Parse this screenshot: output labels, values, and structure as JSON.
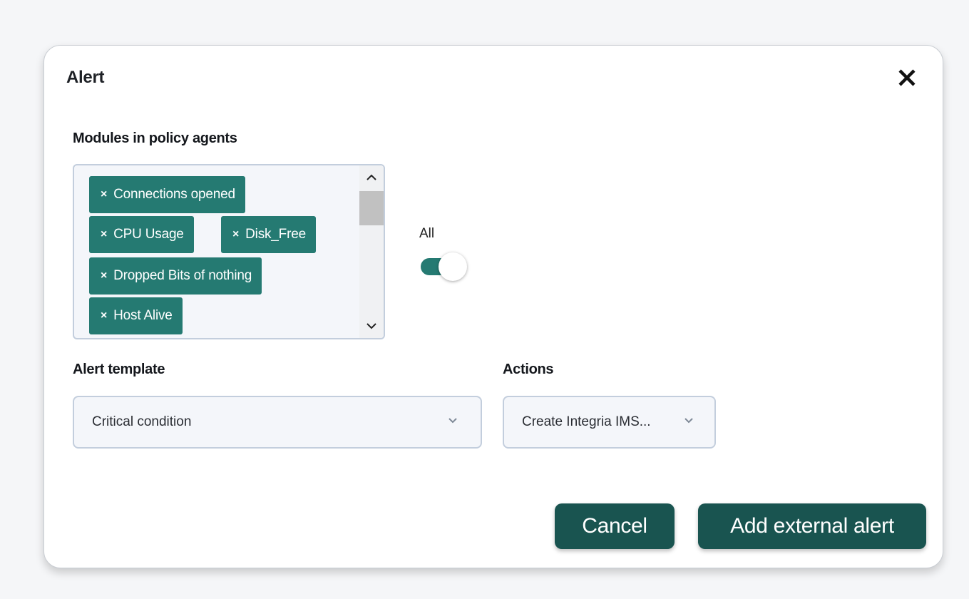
{
  "dialog": {
    "title": "Alert"
  },
  "modules": {
    "label": "Modules in policy agents",
    "tags": [
      "Connections opened",
      "CPU Usage",
      "Disk_Free",
      "Dropped Bits of nothing",
      "Host Alive"
    ],
    "remove_icon": "×"
  },
  "all_toggle": {
    "label": "All",
    "checked": true
  },
  "alert_template": {
    "label": "Alert template",
    "value": "Critical condition"
  },
  "actions": {
    "label": "Actions",
    "value": "Create Integria IMS..."
  },
  "buttons": {
    "cancel": "Cancel",
    "add": "Add external alert"
  },
  "colors": {
    "accent": "#257a72",
    "button": "#195450"
  }
}
